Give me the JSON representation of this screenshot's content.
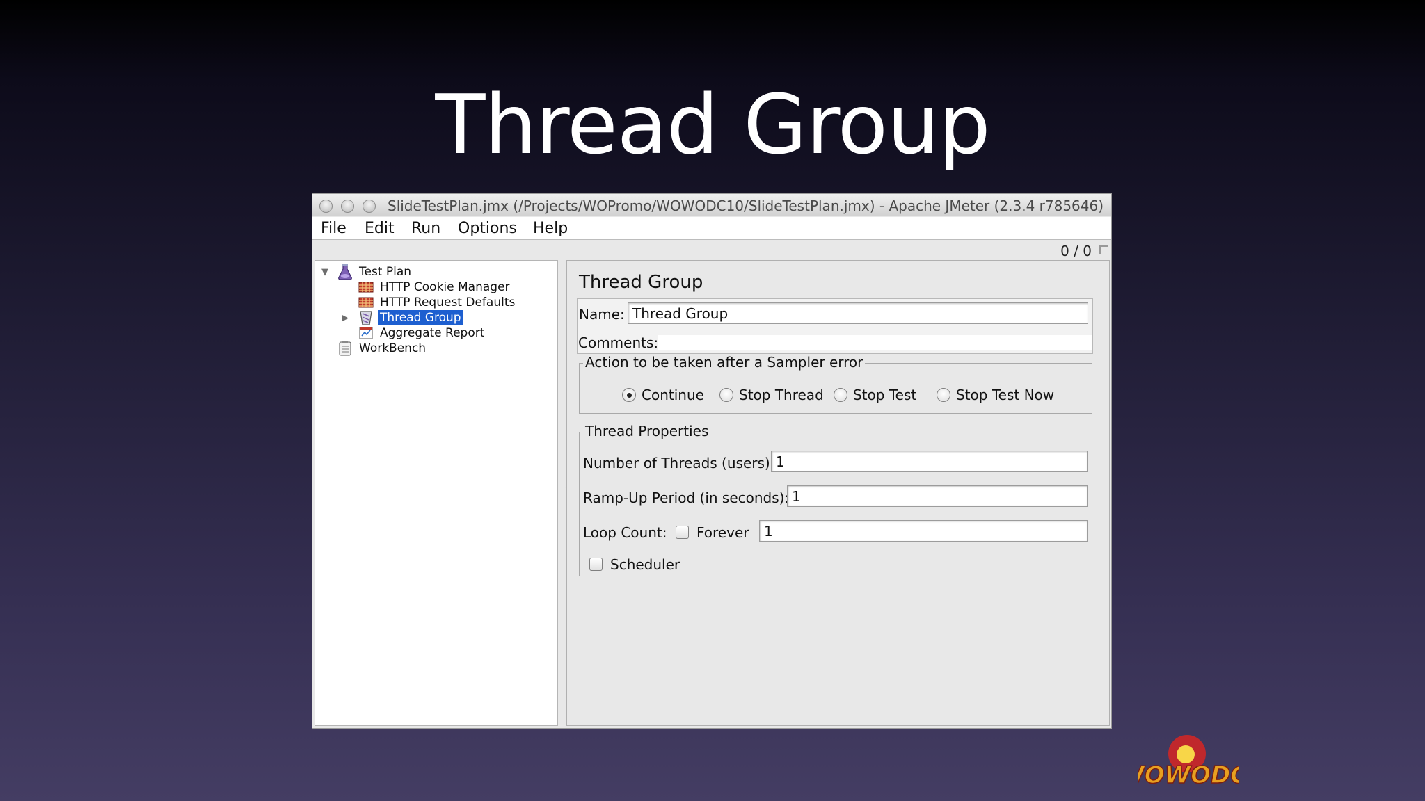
{
  "slide": {
    "title": "Thread Group"
  },
  "window": {
    "title": "SlideTestPlan.jmx (/Projects/WOPromo/WOWODC10/SlideTestPlan.jmx) - Apache JMeter (2.3.4 r785646)",
    "menu": [
      "File",
      "Edit",
      "Run",
      "Options",
      "Help"
    ],
    "status_count": "0 / 0"
  },
  "tree": {
    "items": [
      {
        "label": "Test Plan",
        "icon": "flask-icon",
        "expanded": true
      },
      {
        "label": "HTTP Cookie Manager",
        "icon": "config-element-icon"
      },
      {
        "label": "HTTP Request Defaults",
        "icon": "config-element-icon"
      },
      {
        "label": "Thread Group",
        "icon": "thread-group-icon",
        "selected": true,
        "collapsed": true
      },
      {
        "label": "Aggregate Report",
        "icon": "listener-icon"
      },
      {
        "label": "WorkBench",
        "icon": "clipboard-icon"
      }
    ]
  },
  "panel": {
    "title": "Thread Group",
    "name_label": "Name:",
    "name_value": "Thread Group",
    "comments_label": "Comments:",
    "sampler_error": {
      "legend": "Action to be taken after a Sampler error",
      "options": [
        "Continue",
        "Stop Thread",
        "Stop Test",
        "Stop Test Now"
      ],
      "selected": "Continue"
    },
    "thread_props": {
      "legend": "Thread Properties",
      "threads_label": "Number of Threads (users):",
      "threads_value": "1",
      "rampup_label": "Ramp-Up Period (in seconds):",
      "rampup_value": "1",
      "loop_label": "Loop Count:",
      "forever_label": "Forever",
      "forever_checked": false,
      "loop_value": "1",
      "scheduler_label": "Scheduler",
      "scheduler_checked": false
    }
  },
  "logo": {
    "text": "WOWODC!"
  },
  "colors": {
    "selection": "#1d5fd0",
    "logo_orange": "#e8a020",
    "logo_red": "#c0282c",
    "logo_yellow": "#f8d648"
  }
}
